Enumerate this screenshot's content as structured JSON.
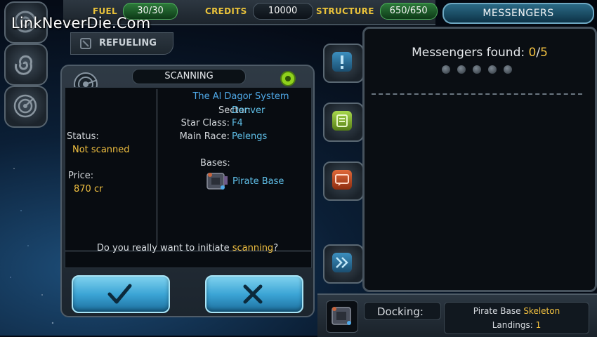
{
  "watermark": "LinkNeverDie.Com",
  "topbar": {
    "fuel_label": "FUEL",
    "fuel_value": "30/30",
    "credits_label": "CREDITS",
    "credits_value": "10000",
    "structure_label": "STRUCTURE",
    "structure_value": "650/650",
    "messengers_tab": "MESSENGERS"
  },
  "refueling_label": "REFUELING",
  "dialog": {
    "title": "SCANNING",
    "system_name": "The Al Dagor System",
    "sector_label": "Sector:",
    "sector_value": "Denver",
    "star_class_label": "Star Class:",
    "star_class_value": "F4",
    "main_race_label": "Main Race:",
    "main_race_value": "Pelengs",
    "bases_label": "Bases:",
    "base_name": "Pirate Base",
    "status_label": "Status:",
    "status_value": "Not scanned",
    "price_label": "Price:",
    "price_value": "870 cr",
    "question_prefix": "Do you really want to initiate ",
    "question_highlight": "scanning",
    "question_suffix": "?",
    "confirm_icon": "check-icon",
    "cancel_icon": "x-icon"
  },
  "messengers": {
    "found_label": "Messengers found: ",
    "found_count": "0",
    "found_sep": "/",
    "found_total": "5"
  },
  "docking": {
    "label": "Docking:",
    "station_prefix": "Pirate Base ",
    "station_name": "Skeleton",
    "landings_label": "Landings: ",
    "landings_value": "1"
  },
  "colors": {
    "accent_yellow": "#f1c040",
    "accent_blue": "#4fa9e8",
    "button_blue": "#3ca5d6"
  }
}
